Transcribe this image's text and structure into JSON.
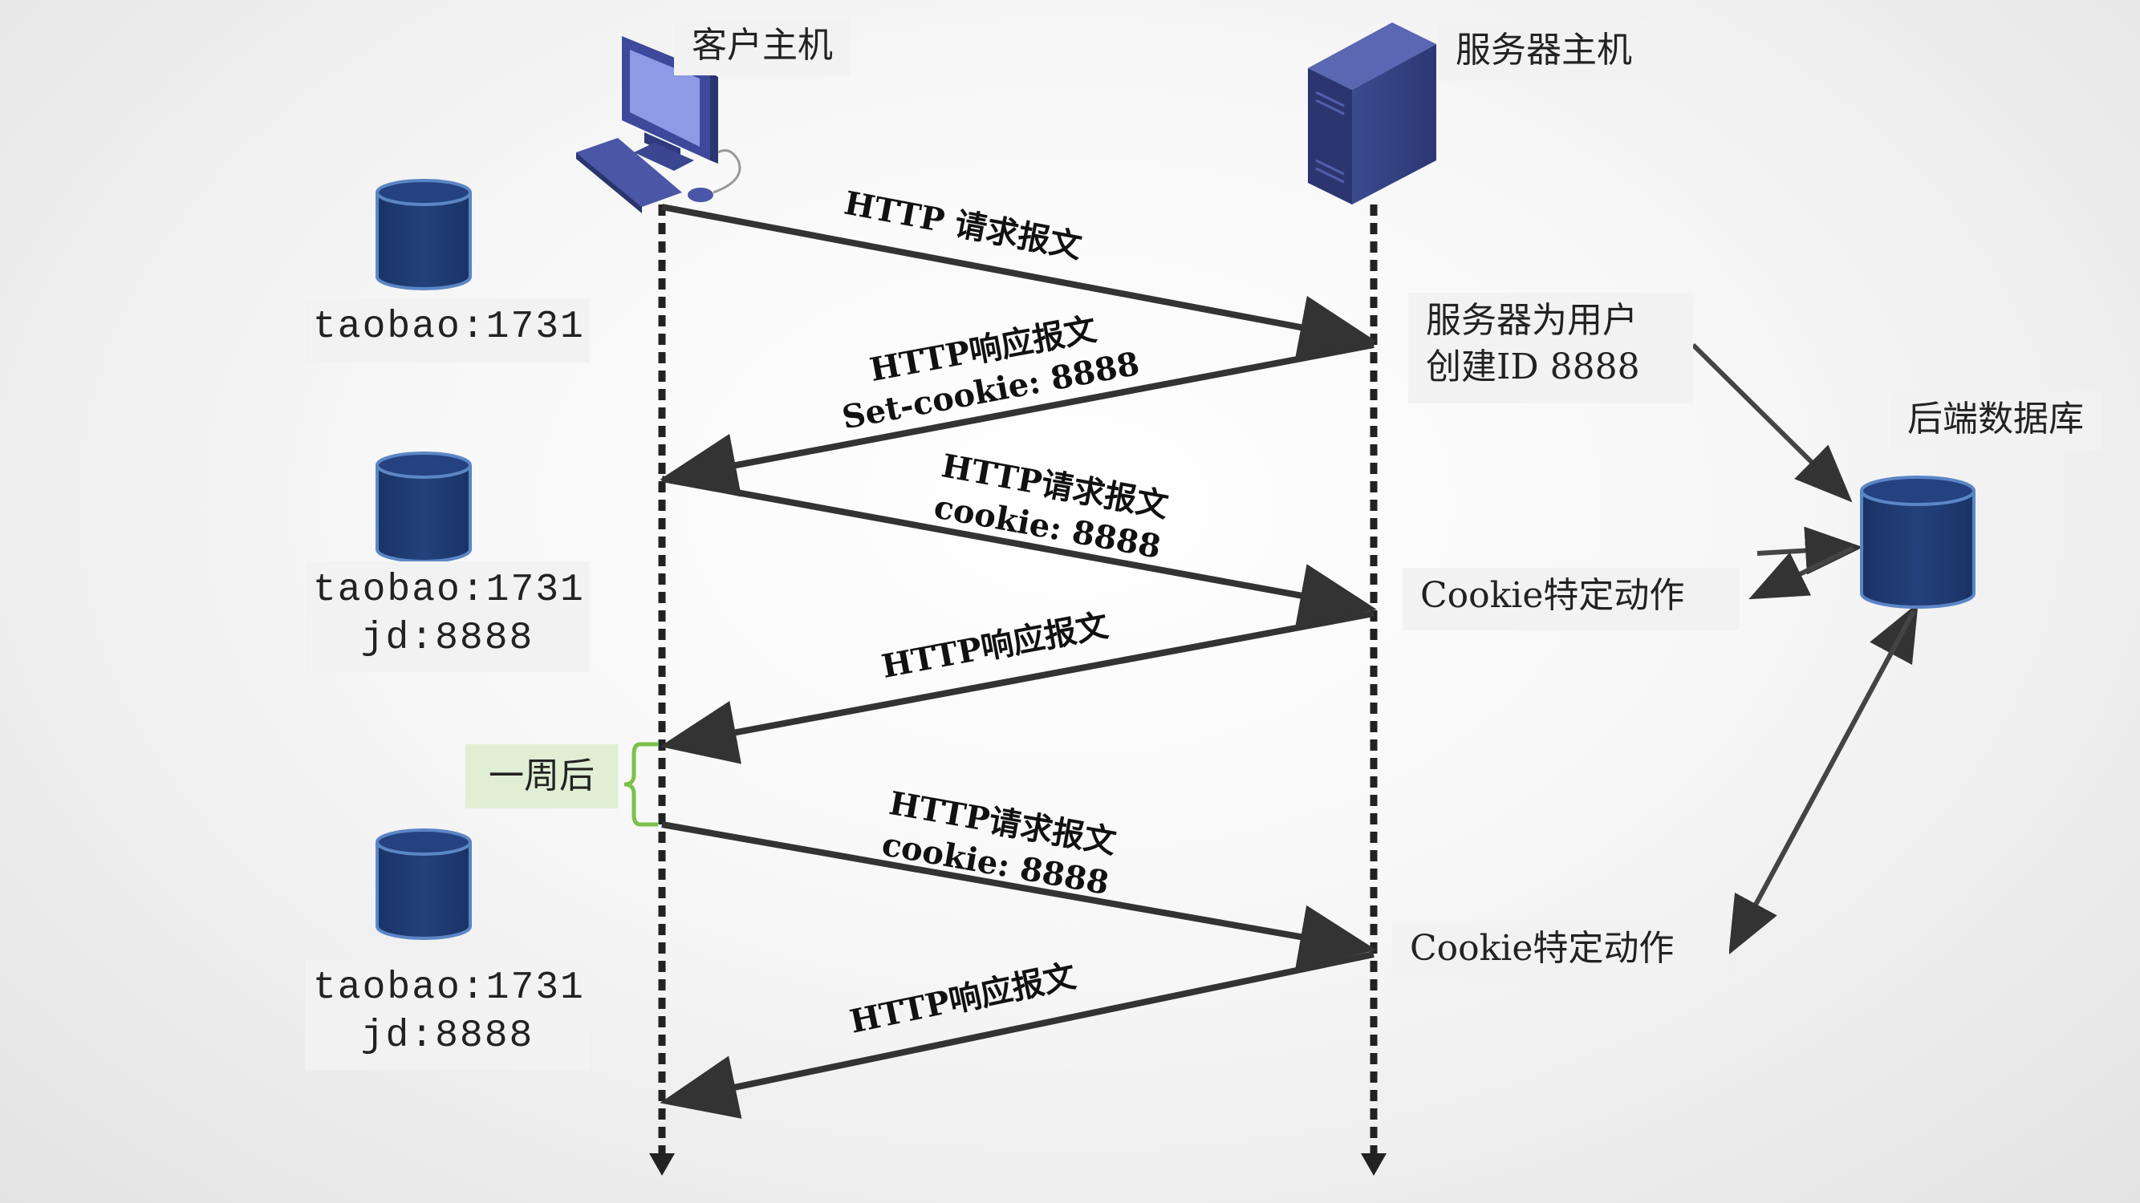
{
  "client": {
    "title": "客户主机"
  },
  "server": {
    "title": "服务器主机"
  },
  "database": {
    "title": "后端数据库"
  },
  "cookie_stores": [
    {
      "text": "taobao:1731"
    },
    {
      "text": "taobao:1731\njd:8888"
    },
    {
      "text": "taobao:1731\njd:8888"
    }
  ],
  "messages": [
    {
      "text": "HTTP 请求报文"
    },
    {
      "text": "HTTP响应报文\nSet-cookie: 8888"
    },
    {
      "text": "HTTP请求报文\ncookie: 8888"
    },
    {
      "text": "HTTP响应报文"
    },
    {
      "text": "HTTP请求报文\ncookie: 8888"
    },
    {
      "text": "HTTP响应报文"
    }
  ],
  "server_notes": {
    "create_id": "服务器为用户\n创建ID 8888",
    "action_1": "Cookie特定动作",
    "action_2": "Cookie特定动作"
  },
  "week_later": "一周后",
  "colors": {
    "arrow": "#333333",
    "cylinder_fill": "#1f3a70",
    "cylinder_stroke": "#5b86c6",
    "computer": "#3d4a9b",
    "brace": "#7cc04a",
    "week_bg": "#e0efd4"
  },
  "icons": [
    "computer-icon",
    "server-icon",
    "database-icon"
  ]
}
